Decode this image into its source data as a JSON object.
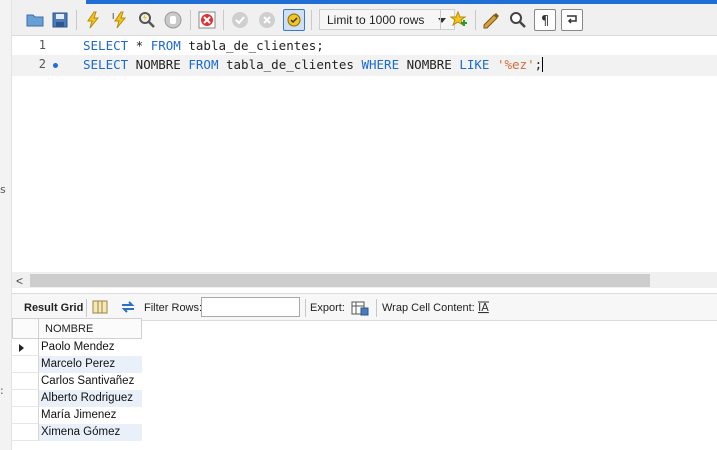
{
  "toolbar": {
    "limit_select": {
      "selected": "Limit to 1000 rows"
    },
    "accent_color": "#1f6fd4",
    "icons": [
      "open-folder-icon",
      "save-icon",
      "execute-icon",
      "execute-current-icon",
      "explain-icon",
      "stop-icon",
      "toggle-error-icon",
      "commit-icon",
      "rollback-icon",
      "autocommit-icon",
      "add-snippet-icon",
      "beautify-icon",
      "find-icon",
      "invisible-chars-icon",
      "wrap-lines-icon"
    ]
  },
  "editor": {
    "lines": [
      {
        "number": "1",
        "tokens": [
          {
            "t": "SELECT",
            "k": "kw"
          },
          {
            "t": " * ",
            "k": ""
          },
          {
            "t": "FROM",
            "k": "kw"
          },
          {
            "t": " tabla_de_clientes;",
            "k": ""
          }
        ]
      },
      {
        "number": "2",
        "tokens": [
          {
            "t": "SELECT",
            "k": "kw"
          },
          {
            "t": " NOMBRE ",
            "k": ""
          },
          {
            "t": "FROM",
            "k": "kw"
          },
          {
            "t": " tabla_de_clientes ",
            "k": ""
          },
          {
            "t": "WHERE",
            "k": "kw"
          },
          {
            "t": " NOMBRE ",
            "k": ""
          },
          {
            "t": "LIKE",
            "k": "kw"
          },
          {
            "t": " ",
            "k": ""
          },
          {
            "t": "'%ez'",
            "k": "str"
          },
          {
            "t": ";",
            "k": ""
          }
        ]
      }
    ],
    "keyword_color": "#1a6ad2",
    "string_color": "#d46a3a"
  },
  "results": {
    "tab_label": "Result Grid",
    "filter_label": "Filter Rows:",
    "filter_value": "",
    "export_label": "Export:",
    "wrap_label": "Wrap Cell Content:",
    "column": "NOMBRE",
    "rows": [
      "Paolo Mendez",
      "Marcelo Perez",
      "Carlos Santivañez",
      "Alberto Rodriguez",
      "María Jimenez",
      "Ximena Gómez"
    ]
  },
  "left_strip": {
    "marks": [
      "s",
      ":"
    ]
  }
}
